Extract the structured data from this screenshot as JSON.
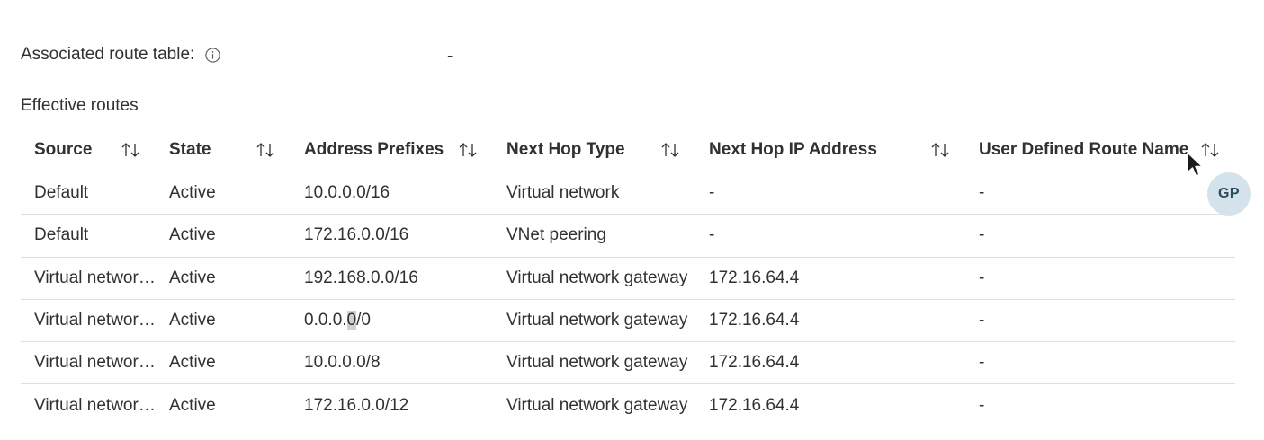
{
  "associated_route_table": {
    "label": "Associated route table:",
    "value": "-"
  },
  "effective_routes": {
    "title": "Effective routes",
    "columns": [
      "Source",
      "State",
      "Address Prefixes",
      "Next Hop Type",
      "Next Hop IP Address",
      "User Defined Route Name"
    ],
    "rows": [
      [
        "Default",
        "Active",
        "10.0.0.0/16",
        "Virtual network",
        "-",
        "-"
      ],
      [
        "Default",
        "Active",
        "172.16.0.0/16",
        "VNet peering",
        "-",
        "-"
      ],
      [
        "Virtual network gateway",
        "Active",
        "192.168.0.0/16",
        "Virtual network gateway",
        "172.16.64.4",
        "-"
      ],
      [
        "Virtual network gateway",
        "Active",
        "0.0.0.0/0",
        "Virtual network gateway",
        "172.16.64.4",
        "-"
      ],
      [
        "Virtual network gateway",
        "Active",
        "10.0.0.0/8",
        "Virtual network gateway",
        "172.16.64.4",
        "-"
      ],
      [
        "Virtual network gateway",
        "Active",
        "172.16.0.0/12",
        "Virtual network gateway",
        "172.16.64.4",
        "-"
      ]
    ],
    "highlight": {
      "row": 3,
      "before": "0.0.0.",
      "selected": "0",
      "after": "/0"
    }
  },
  "avatar": {
    "initials": "GP",
    "background": "#d4e3eb"
  },
  "icons": {
    "info": "info-icon",
    "sort": "sort-up-down-icon",
    "cursor": "mouse-cursor-icon"
  }
}
